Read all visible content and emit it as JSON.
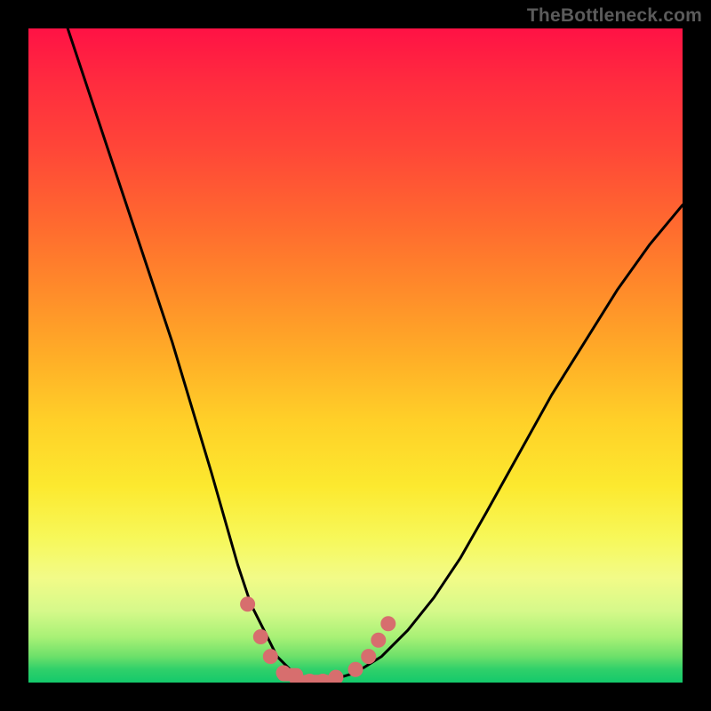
{
  "watermark": {
    "text": "TheBottleneck.com"
  },
  "colors": {
    "curve_stroke": "#000000",
    "marker_fill": "#d76e6e",
    "marker_stroke": "#d76e6e",
    "gradient_stops": [
      "#ff1245",
      "#ff2b3f",
      "#ff4538",
      "#ff6a2f",
      "#ff8b2a",
      "#ffad27",
      "#ffd028",
      "#fce92f",
      "#f7f85a",
      "#f2fb88",
      "#d6f98a",
      "#a9f176",
      "#6de06a",
      "#2fd06a",
      "#14c96b"
    ]
  },
  "chart_data": {
    "type": "line",
    "title": "",
    "xlabel": "",
    "ylabel": "",
    "xlim": [
      0,
      100
    ],
    "ylim": [
      0,
      100
    ],
    "grid": false,
    "legend": false,
    "series": [
      {
        "name": "bottleneck-curve",
        "x": [
          6,
          10,
          14,
          18,
          22,
          25,
          28,
          30,
          32,
          34,
          36,
          38,
          40,
          42,
          44,
          46,
          50,
          54,
          58,
          62,
          66,
          70,
          75,
          80,
          85,
          90,
          95,
          100
        ],
        "y": [
          100,
          88,
          76,
          64,
          52,
          42,
          32,
          25,
          18,
          12,
          8,
          4,
          2,
          0.5,
          0,
          0.3,
          1.5,
          4,
          8,
          13,
          19,
          26,
          35,
          44,
          52,
          60,
          67,
          73
        ]
      }
    ],
    "markers": [
      {
        "x": 33.5,
        "y": 12
      },
      {
        "x": 35.5,
        "y": 7
      },
      {
        "x": 37,
        "y": 4
      },
      {
        "x": 39,
        "y": 1.5
      },
      {
        "x": 41,
        "y": 0.6
      },
      {
        "x": 43,
        "y": 0.2
      },
      {
        "x": 45,
        "y": 0.2
      },
      {
        "x": 47,
        "y": 0.8
      },
      {
        "x": 50,
        "y": 2
      },
      {
        "x": 52,
        "y": 4
      },
      {
        "x": 53.5,
        "y": 6.5
      },
      {
        "x": 55,
        "y": 9
      }
    ],
    "marker_blobs": [
      {
        "x": 40,
        "y": 1.2,
        "w": 4,
        "h": 2
      },
      {
        "x": 44,
        "y": 0.3,
        "w": 5,
        "h": 1.8
      }
    ]
  }
}
